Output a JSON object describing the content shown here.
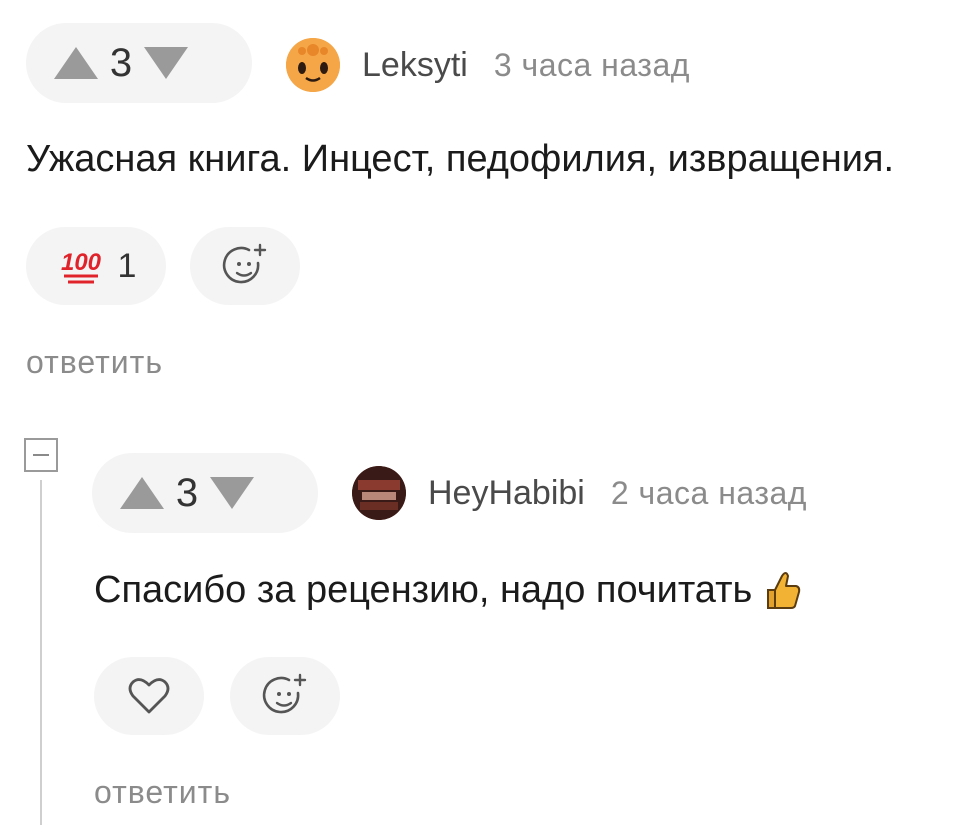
{
  "comments": [
    {
      "score": "3",
      "author": "Leksyti",
      "time": "3 часа назад",
      "text": "Ужасная книга. Инцест, педофилия, извращения.",
      "reaction_emoji": "100",
      "reaction_count": "1",
      "reply_label": "ответить",
      "avatar_color": "#f3a24a"
    },
    {
      "score": "3",
      "author": "HeyHabibi",
      "time": "2 часа назад",
      "text": "Спасибо за рецензию, надо почитать",
      "reply_label": "ответить",
      "avatar_color": "#5a2a22"
    }
  ],
  "icons": {
    "upvote": "triangle-up-icon",
    "downvote": "triangle-down-icon",
    "add_reaction": "smiley-plus-icon",
    "like": "heart-icon",
    "thumbs_up": "thumbs-up-emoji",
    "collapse": "minus-box-icon"
  },
  "colors": {
    "pill_bg": "#f4f4f4",
    "arrow": "#9a9a9a",
    "reaction_red": "#e0232b",
    "thumb": "#f2b233"
  }
}
